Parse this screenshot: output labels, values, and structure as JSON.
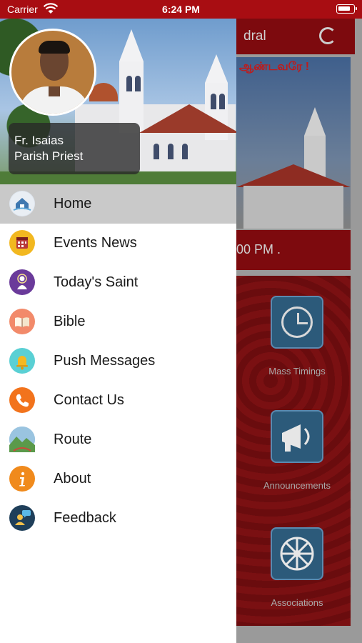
{
  "status_bar": {
    "carrier": "Carrier",
    "time": "6:24 PM"
  },
  "background": {
    "header_title": "dral",
    "banner_text": "ஆண்டவரே !",
    "marquee_text": "00 PM .",
    "tiles": [
      {
        "label": "Mass Timings",
        "icon": "clock-icon"
      },
      {
        "label": "Announcements",
        "icon": "megaphone-icon"
      },
      {
        "label": "Associations",
        "icon": "wheel-icon"
      }
    ],
    "colors": {
      "header": "#7d0a0e",
      "grid": "#6a0c0e",
      "tile_icon": "#2c5a7a"
    }
  },
  "drawer": {
    "profile": {
      "name": "Fr. Isaias",
      "role": "Parish Priest"
    },
    "menu": [
      {
        "label": "Home",
        "icon": "home-icon",
        "active": true
      },
      {
        "label": "Events News",
        "icon": "calendar-icon",
        "active": false
      },
      {
        "label": "Today's Saint",
        "icon": "saint-icon",
        "active": false
      },
      {
        "label": "Bible",
        "icon": "bible-icon",
        "active": false
      },
      {
        "label": "Push Messages",
        "icon": "bell-icon",
        "active": false
      },
      {
        "label": "Contact Us",
        "icon": "phone-icon",
        "active": false
      },
      {
        "label": "Route",
        "icon": "map-icon",
        "active": false
      },
      {
        "label": "About",
        "icon": "info-icon",
        "active": false
      },
      {
        "label": "Feedback",
        "icon": "feedback-icon",
        "active": false
      }
    ],
    "colors": {
      "active_row": "#c9c9c9",
      "status_bar": "#a80d12"
    }
  }
}
